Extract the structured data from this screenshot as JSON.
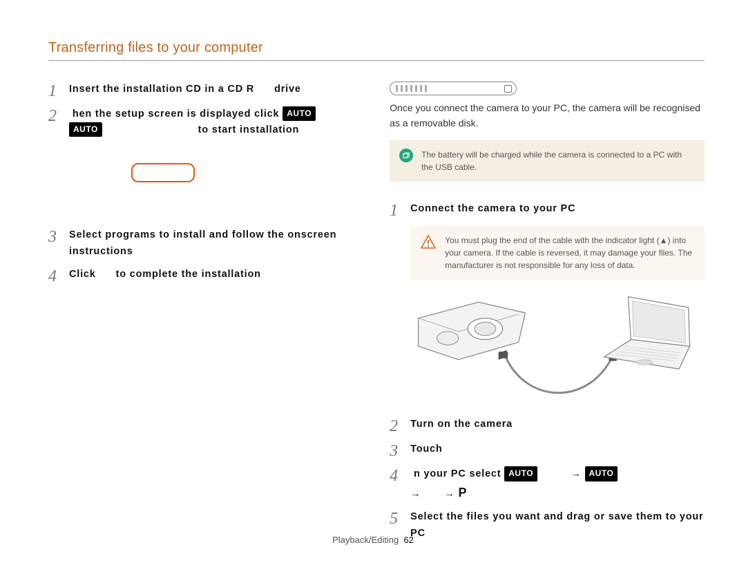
{
  "header": {
    "title": "Transferring files to your computer"
  },
  "left": {
    "steps": [
      {
        "num": "1",
        "parts": [
          "Insert the installation CD in a CD R",
          "drive"
        ]
      },
      {
        "num": "2",
        "parts": [
          "hen the setup screen is displayed  click",
          "AUTO"
        ],
        "line2_badge": "AUTO",
        "line2_tail": "to start installation"
      },
      {
        "num": "3",
        "text": "Select programs to install and follow the onscreen instructions"
      },
      {
        "num": "4",
        "parts": [
          "Click",
          "to complete the installation"
        ]
      }
    ]
  },
  "right": {
    "intro": "Once you connect the camera to your PC, the camera will be recognised as a removable disk.",
    "callout": "The battery will be charged while the camera is connected to a PC with the USB cable.",
    "steps": [
      {
        "num": "1",
        "text": "Connect the camera to your PC"
      },
      {
        "num": "2",
        "text": "Turn on the camera"
      },
      {
        "num": "3",
        "text": "Touch"
      },
      {
        "num": "4",
        "pre": "n your PC  select",
        "b1": "AUTO",
        "arrow1": "→",
        "b2": "AUTO",
        "arrow2": "→",
        "arrow3": "→",
        "Pglyph": "P"
      },
      {
        "num": "5",
        "text": "Select the files you want and drag or save them to your PC"
      }
    ],
    "warning": "You must plug the end of the cable with the indicator light (▲) into your camera. If the cable is reversed, it may damage your files. The manufacturer is not responsible for any loss of data."
  },
  "footer": {
    "section": "Playback/Editing",
    "page": "62"
  }
}
